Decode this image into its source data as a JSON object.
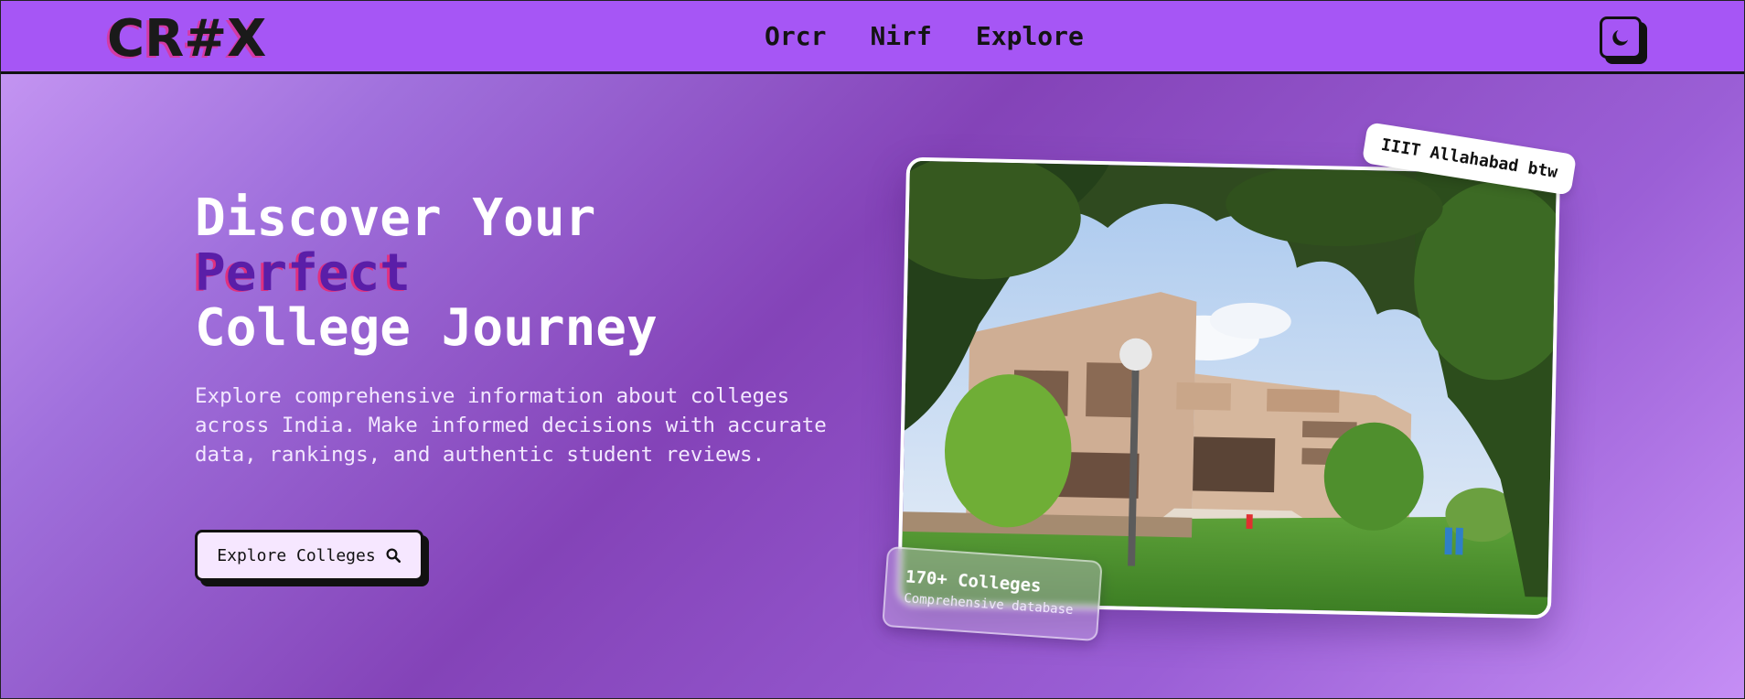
{
  "brand": {
    "logo_text": "CR#X"
  },
  "nav": {
    "links": [
      "Orcr",
      "Nirf",
      "Explore"
    ]
  },
  "theme_toggle": {
    "icon": "moon-icon"
  },
  "hero": {
    "title_line1": "Discover Your",
    "title_accent": "Perfect",
    "title_line3": "College Journey",
    "description": "Explore comprehensive information about colleges across India. Make informed decisions with accurate data, rankings, and authentic student reviews.",
    "cta_label": "Explore Colleges",
    "cta_icon": "search-icon"
  },
  "showcase": {
    "tag_label": "IIIT Allahabad btw",
    "stat_value": "170+ Colleges",
    "stat_label": "Comprehensive database"
  },
  "colors": {
    "navbar": "#a656f5",
    "accent_text": "#5a1ea8",
    "accent_shadow": "#e0317f",
    "border": "#111111"
  }
}
